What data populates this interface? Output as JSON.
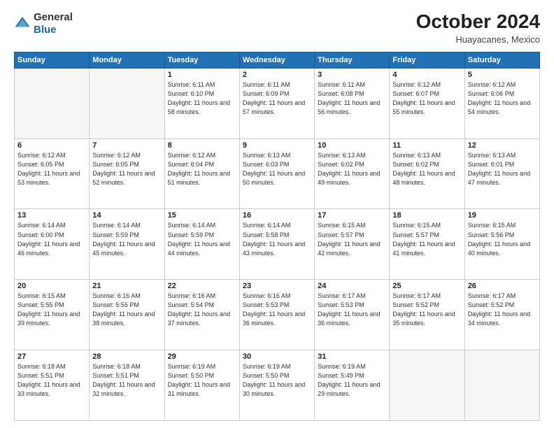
{
  "header": {
    "logo_general": "General",
    "logo_blue": "Blue",
    "month": "October 2024",
    "location": "Huayacanes, Mexico"
  },
  "weekdays": [
    "Sunday",
    "Monday",
    "Tuesday",
    "Wednesday",
    "Thursday",
    "Friday",
    "Saturday"
  ],
  "weeks": [
    [
      {
        "day": "",
        "info": ""
      },
      {
        "day": "",
        "info": ""
      },
      {
        "day": "1",
        "info": "Sunrise: 6:11 AM\nSunset: 6:10 PM\nDaylight: 11 hours and 58 minutes."
      },
      {
        "day": "2",
        "info": "Sunrise: 6:11 AM\nSunset: 6:09 PM\nDaylight: 11 hours and 57 minutes."
      },
      {
        "day": "3",
        "info": "Sunrise: 6:11 AM\nSunset: 6:08 PM\nDaylight: 11 hours and 56 minutes."
      },
      {
        "day": "4",
        "info": "Sunrise: 6:12 AM\nSunset: 6:07 PM\nDaylight: 11 hours and 55 minutes."
      },
      {
        "day": "5",
        "info": "Sunrise: 6:12 AM\nSunset: 6:06 PM\nDaylight: 11 hours and 54 minutes."
      }
    ],
    [
      {
        "day": "6",
        "info": "Sunrise: 6:12 AM\nSunset: 6:05 PM\nDaylight: 11 hours and 53 minutes."
      },
      {
        "day": "7",
        "info": "Sunrise: 6:12 AM\nSunset: 6:05 PM\nDaylight: 11 hours and 52 minutes."
      },
      {
        "day": "8",
        "info": "Sunrise: 6:12 AM\nSunset: 6:04 PM\nDaylight: 11 hours and 51 minutes."
      },
      {
        "day": "9",
        "info": "Sunrise: 6:13 AM\nSunset: 6:03 PM\nDaylight: 11 hours and 50 minutes."
      },
      {
        "day": "10",
        "info": "Sunrise: 6:13 AM\nSunset: 6:02 PM\nDaylight: 11 hours and 49 minutes."
      },
      {
        "day": "11",
        "info": "Sunrise: 6:13 AM\nSunset: 6:02 PM\nDaylight: 11 hours and 48 minutes."
      },
      {
        "day": "12",
        "info": "Sunrise: 6:13 AM\nSunset: 6:01 PM\nDaylight: 11 hours and 47 minutes."
      }
    ],
    [
      {
        "day": "13",
        "info": "Sunrise: 6:14 AM\nSunset: 6:00 PM\nDaylight: 11 hours and 46 minutes."
      },
      {
        "day": "14",
        "info": "Sunrise: 6:14 AM\nSunset: 5:59 PM\nDaylight: 11 hours and 45 minutes."
      },
      {
        "day": "15",
        "info": "Sunrise: 6:14 AM\nSunset: 5:59 PM\nDaylight: 11 hours and 44 minutes."
      },
      {
        "day": "16",
        "info": "Sunrise: 6:14 AM\nSunset: 5:58 PM\nDaylight: 11 hours and 43 minutes."
      },
      {
        "day": "17",
        "info": "Sunrise: 6:15 AM\nSunset: 5:57 PM\nDaylight: 11 hours and 42 minutes."
      },
      {
        "day": "18",
        "info": "Sunrise: 6:15 AM\nSunset: 5:57 PM\nDaylight: 11 hours and 41 minutes."
      },
      {
        "day": "19",
        "info": "Sunrise: 6:15 AM\nSunset: 5:56 PM\nDaylight: 11 hours and 40 minutes."
      }
    ],
    [
      {
        "day": "20",
        "info": "Sunrise: 6:15 AM\nSunset: 5:55 PM\nDaylight: 11 hours and 39 minutes."
      },
      {
        "day": "21",
        "info": "Sunrise: 6:16 AM\nSunset: 5:55 PM\nDaylight: 11 hours and 38 minutes."
      },
      {
        "day": "22",
        "info": "Sunrise: 6:16 AM\nSunset: 5:54 PM\nDaylight: 11 hours and 37 minutes."
      },
      {
        "day": "23",
        "info": "Sunrise: 6:16 AM\nSunset: 5:53 PM\nDaylight: 11 hours and 36 minutes."
      },
      {
        "day": "24",
        "info": "Sunrise: 6:17 AM\nSunset: 5:53 PM\nDaylight: 11 hours and 36 minutes."
      },
      {
        "day": "25",
        "info": "Sunrise: 6:17 AM\nSunset: 5:52 PM\nDaylight: 11 hours and 35 minutes."
      },
      {
        "day": "26",
        "info": "Sunrise: 6:17 AM\nSunset: 5:52 PM\nDaylight: 11 hours and 34 minutes."
      }
    ],
    [
      {
        "day": "27",
        "info": "Sunrise: 6:18 AM\nSunset: 5:51 PM\nDaylight: 11 hours and 33 minutes."
      },
      {
        "day": "28",
        "info": "Sunrise: 6:18 AM\nSunset: 5:51 PM\nDaylight: 11 hours and 32 minutes."
      },
      {
        "day": "29",
        "info": "Sunrise: 6:19 AM\nSunset: 5:50 PM\nDaylight: 11 hours and 31 minutes."
      },
      {
        "day": "30",
        "info": "Sunrise: 6:19 AM\nSunset: 5:50 PM\nDaylight: 11 hours and 30 minutes."
      },
      {
        "day": "31",
        "info": "Sunrise: 6:19 AM\nSunset: 5:49 PM\nDaylight: 11 hours and 29 minutes."
      },
      {
        "day": "",
        "info": ""
      },
      {
        "day": "",
        "info": ""
      }
    ]
  ]
}
